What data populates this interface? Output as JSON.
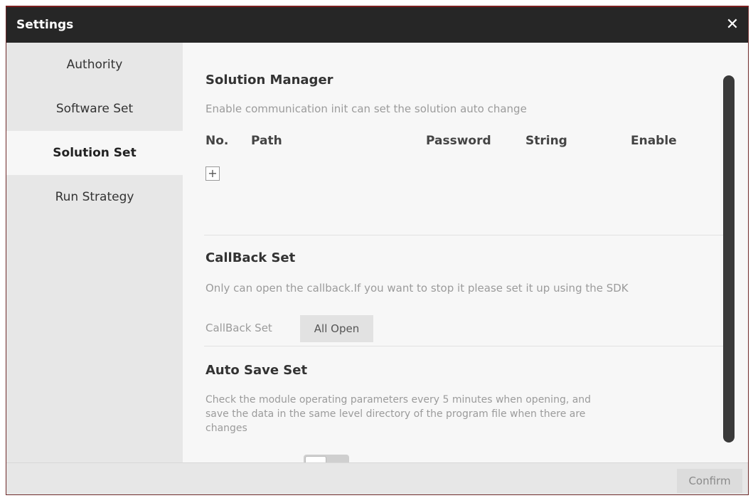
{
  "window": {
    "title": "Settings"
  },
  "sidebar": {
    "items": [
      {
        "label": "Authority"
      },
      {
        "label": "Software Set"
      },
      {
        "label": "Solution Set"
      },
      {
        "label": "Run Strategy"
      }
    ],
    "active_index": 2
  },
  "solution_manager": {
    "title": "Solution Manager",
    "description": "Enable communication init can set the solution auto change",
    "columns": [
      "No.",
      "Path",
      "Password",
      "String",
      "Enable"
    ],
    "add_icon": "plus-icon"
  },
  "callback_set": {
    "title": "CallBack Set",
    "description": "Only can open the callback.If you want to stop it please set it up using the SDK",
    "field_label": "CallBack Set",
    "button_label": "All Open"
  },
  "auto_save_set": {
    "title": "Auto Save Set",
    "description_line1": "Check the module operating parameters every 5 minutes when opening, and",
    "description_line2": "save the data in the same level directory of the program file when there are",
    "description_line3": "changes"
  },
  "footer": {
    "confirm_label": "Confirm"
  },
  "colors": {
    "titlebar": "#262626",
    "accent_border": "#7a1f1f",
    "sidebar_bg": "#e7e7e7",
    "content_bg": "#f7f7f7",
    "scrollbar": "#3a3a3a"
  }
}
